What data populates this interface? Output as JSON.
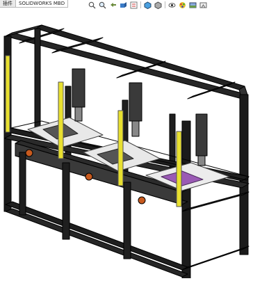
{
  "command_manager": {
    "tabs": [
      {
        "label": "插件",
        "active": false
      },
      {
        "label": "SOLIDWORKS MBD",
        "active": true
      }
    ]
  },
  "heads_up_toolbar": {
    "buttons": [
      {
        "icon": "zoom-to-fit-icon"
      },
      {
        "icon": "zoom-to-area-icon"
      },
      {
        "icon": "previous-view-icon"
      },
      {
        "icon": "section-view-icon"
      },
      {
        "icon": "dynamic-annotation-icon"
      },
      {
        "icon": "view-orientation-icon"
      },
      {
        "icon": "display-style-icon"
      },
      {
        "icon": "hide-show-items-icon"
      },
      {
        "icon": "edit-appearance-icon"
      },
      {
        "icon": "apply-scene-icon"
      },
      {
        "icon": "view-settings-icon"
      }
    ]
  },
  "model": {
    "description_colors": {
      "frame": "#1b1b1b",
      "light_curtain": "#e8e030",
      "plate": "#e6e6e6",
      "button": "#c85a1e",
      "fixture_accent": "#8a4aa8"
    }
  }
}
